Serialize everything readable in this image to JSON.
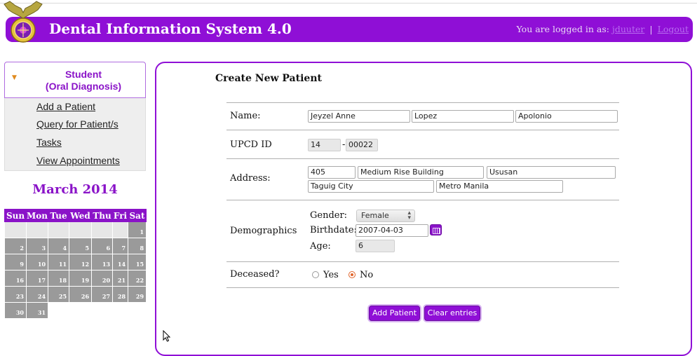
{
  "header": {
    "title": "Dental Information System 4.0",
    "logged_in_label": "You are logged in as:",
    "username": "jduuter",
    "separator": "|",
    "logout": "Logout"
  },
  "sidebar": {
    "section_title_line1": "Student",
    "section_title_line2": "(Oral Diagnosis)",
    "items": [
      {
        "label": "Add a Patient"
      },
      {
        "label": "Query for Patient/s"
      },
      {
        "label": "Tasks"
      },
      {
        "label": "View Appointments"
      }
    ]
  },
  "calendar": {
    "month_label": "March 2014",
    "weekdays": [
      "Sun",
      "Mon",
      "Tue",
      "Wed",
      "Thu",
      "Fri",
      "Sat"
    ],
    "weeks": [
      [
        "",
        "",
        "",
        "",
        "",
        "",
        "1"
      ],
      [
        "2",
        "3",
        "4",
        "5",
        "6",
        "7",
        "8"
      ],
      [
        "9",
        "10",
        "11",
        "12",
        "13",
        "14",
        "15"
      ],
      [
        "16",
        "17",
        "18",
        "19",
        "20",
        "21",
        "22"
      ],
      [
        "23",
        "24",
        "25",
        "26",
        "27",
        "28",
        "29"
      ],
      [
        "30",
        "31",
        "",
        "",
        "",
        "",
        ""
      ]
    ]
  },
  "form": {
    "title": "Create New Patient",
    "name_label": "Name:",
    "first_name": "Jeyzel Anne",
    "middle_name": "Lopez",
    "last_name": "Apolonio",
    "upcd_label": "UPCD ID",
    "upcd_prefix": "14",
    "upcd_dash": "-",
    "upcd_number": "00022",
    "address_label": "Address:",
    "address_number": "405",
    "address_street": "Medium Rise Building",
    "address_barangay": "Ususan",
    "address_city": "Taguig City",
    "address_province": "Metro Manila",
    "demographics_label": "Demographics",
    "gender_label": "Gender:",
    "gender_value": "Female",
    "birthdate_label": "Birthdate:",
    "birthdate_value": "2007-04-03",
    "age_label": "Age:",
    "age_value": "6",
    "deceased_label": "Deceased?",
    "deceased_yes": "Yes",
    "deceased_no": "No",
    "add_button": "Add Patient",
    "clear_button": "Clear entries"
  },
  "colors": {
    "brand": "#8f0fd6",
    "accent_text": "#8a13c8"
  },
  "icons": {
    "logo": "seal-logo-icon",
    "calendar_button": "calendar-icon",
    "cursor": "mouse-pointer-icon"
  }
}
